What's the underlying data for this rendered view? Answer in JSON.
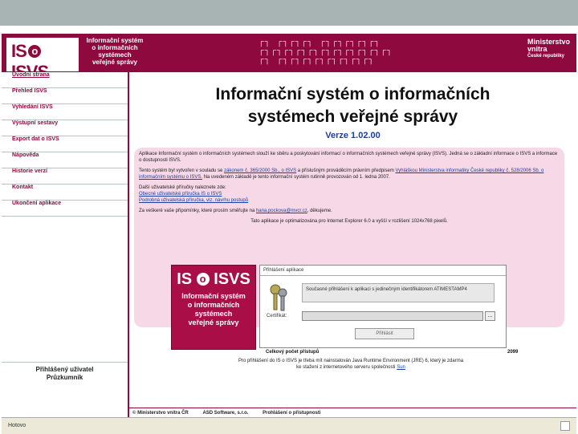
{
  "banner": {
    "logo": "IS o ISVS",
    "subtitle_lines": [
      "Informační systém",
      "o informačních",
      "systémech",
      "veřejné správy"
    ],
    "ministry_lines": [
      "Ministerstvo",
      "vnitra",
      "České republiky"
    ]
  },
  "sidebar": {
    "items": [
      {
        "label": "Úvodní strana"
      },
      {
        "label": "Přehled ISVS"
      },
      {
        "label": "Vyhledání ISVS"
      },
      {
        "label": "Výstupní sestavy"
      },
      {
        "label": "Export dat o ISVS"
      },
      {
        "label": "Nápověda"
      },
      {
        "label": "Historie verzí"
      },
      {
        "label": "Kontakt"
      },
      {
        "label": "Ukončení aplikace"
      }
    ],
    "user_label": "Přihlášený uživatel",
    "user_name": "Průzkumník"
  },
  "main": {
    "title_line1": "Informační systém o informačních",
    "title_line2": "systémech veřejné správy",
    "version": "Verze 1.02.00",
    "info_p1": "Aplikace Informační systém o informačních systémech slouží ke sběru a poskytování informací o informačních systémech veřejné správy (ISVS). Jedná se o základní informace o ISVS a informace o dostupnosti ISVS.",
    "info_p2_prefix": "Tento systém byl vytvořen v souladu se",
    "info_p2_link1": "zákonem č. 365/2000 Sb., o ISVS",
    "info_p2_mid": "a příslušným prováděcím právním předpisem",
    "info_p2_link2": "Vyhláškou Ministerstva informatiky České republiky č. 528/2006 Sb. o informačním systému o ISVS.",
    "info_p2_suffix": "Na uvedeném základě je tento informační systém rutinně provozován od 1. ledna 2007.",
    "info_p3": "Další uživatelské příručky naleznete zde:",
    "info_link_a": "Obecné uživatelské příručka IS o ISVS",
    "info_link_b": "Podrobná uživatelská příručka, viz. návrhu postupů",
    "contact_prefix": "Za veškeré vaše připomínky, které prosím směřujte na",
    "contact_email": "hana.pockova@mvcr.cz",
    "contact_suffix": ", děkujeme.",
    "optimized": "Tato aplikace je optimalizována pro Internet Explorer 6.0 a vyšší v rozlišení 1024x768 pixelů."
  },
  "login": {
    "box_title": "Přihlášení aplikace",
    "cert_text": "Současné přihlášení k aplikaci s jedinečným identifikátorem ATIMESTAMP4",
    "cert_label": "Certifikát:",
    "cert_value": "",
    "dots": "...",
    "button": "Přihlásit",
    "logo_title": "IS o ISVS",
    "logo_sub_lines": [
      "Informační systém",
      "o informačních",
      "systémech",
      "veřejné správy"
    ]
  },
  "stats": {
    "label": "Celkový počet přístupů",
    "value": "2099"
  },
  "note": {
    "line1": "Pro přihlášení do IS o ISVS je třeba mít nainstalován Java Runtime Environment (JRE) 6, který je zdarma",
    "line2_prefix": "ke stažení z internetového serveru společnosti",
    "line2_link": "Sun"
  },
  "footer": {
    "items": [
      "© Ministerstvo vnitra ČR",
      "ASD Software, s.r.o.",
      "Prohlášení o přístupnosti"
    ]
  },
  "status": {
    "text": "Hotovo"
  },
  "colors": {
    "brand": "#8e0a3e",
    "info_bg": "#f6d8e6",
    "link": "#1a3fa0"
  }
}
